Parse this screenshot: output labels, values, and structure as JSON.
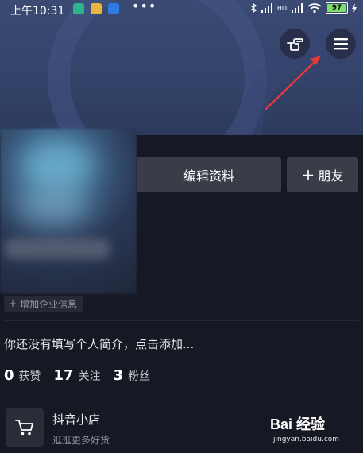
{
  "status_bar": {
    "time": "上午10:31",
    "dots": "•••",
    "battery": "97",
    "signal_label_hd": "HD"
  },
  "header": {
    "gesture_icon": "hand-pointer-icon",
    "menu_icon": "hamburger-menu-icon",
    "annotation_color": "#e23a3a"
  },
  "profile": {
    "edit_button": "编辑资料",
    "add_friend_button": "朋友",
    "add_friend_prefix": "+",
    "enterprise_tag": "增加企业信息",
    "enterprise_prefix": "+",
    "bio_placeholder": "你还没有填写个人简介，点击添加..."
  },
  "stats": [
    {
      "value": "0",
      "label": "获赞"
    },
    {
      "value": "17",
      "label": "关注"
    },
    {
      "value": "3",
      "label": "粉丝"
    }
  ],
  "shop": {
    "title": "抖音小店",
    "subtitle": "逛逛更多好货"
  },
  "watermark": {
    "logo": "Bai 经验",
    "url": "jingyan.baidu.com"
  }
}
